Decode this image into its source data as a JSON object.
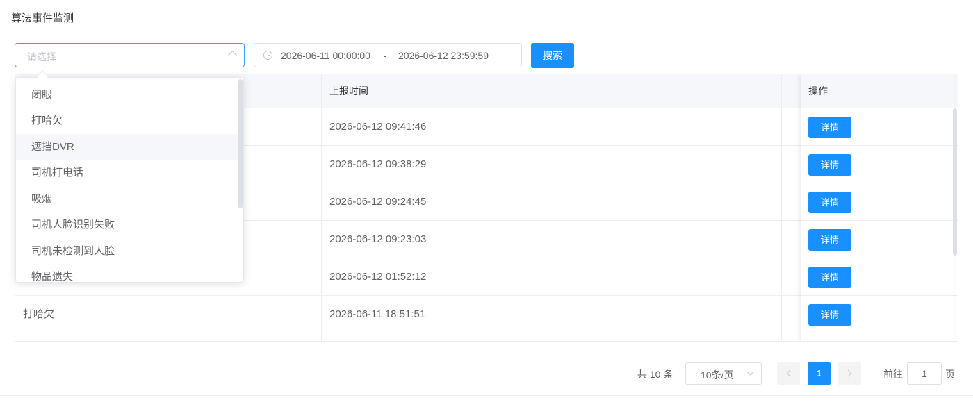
{
  "page": {
    "title": "算法事件监测"
  },
  "filters": {
    "event_type_placeholder": "请选择",
    "date_start": "2026-06-11 00:00:00",
    "date_separator": "-",
    "date_end": "2026-06-12 23:59:59",
    "search_label": "搜索"
  },
  "dropdown": {
    "options": [
      "闭眼",
      "打哈欠",
      "遮挡DVR",
      "司机打电话",
      "吸烟",
      "司机人脸识别失败",
      "司机未检测到人脸",
      "物品遗失"
    ],
    "hovered": "遮挡DVR"
  },
  "table": {
    "columns": [
      "",
      "上报时间",
      "",
      "操作"
    ],
    "rows": [
      {
        "event": "",
        "time": "2026-06-12 09:41:46",
        "action": "详情"
      },
      {
        "event": "",
        "time": "2026-06-12 09:38:29",
        "action": "详情"
      },
      {
        "event": "",
        "time": "2026-06-12 09:24:45",
        "action": "详情"
      },
      {
        "event": "",
        "time": "2026-06-12 09:23:03",
        "action": "详情"
      },
      {
        "event": "",
        "time": "2026-06-12 01:52:12",
        "action": "详情"
      },
      {
        "event": "打哈欠",
        "time": "2026-06-11 18:51:51",
        "action": "详情"
      }
    ]
  },
  "pagination": {
    "total_text": "共 10 条",
    "page_size": "10条/页",
    "current_page": "1",
    "goto_label": "前往",
    "goto_value": "1",
    "page_unit": "页"
  }
}
